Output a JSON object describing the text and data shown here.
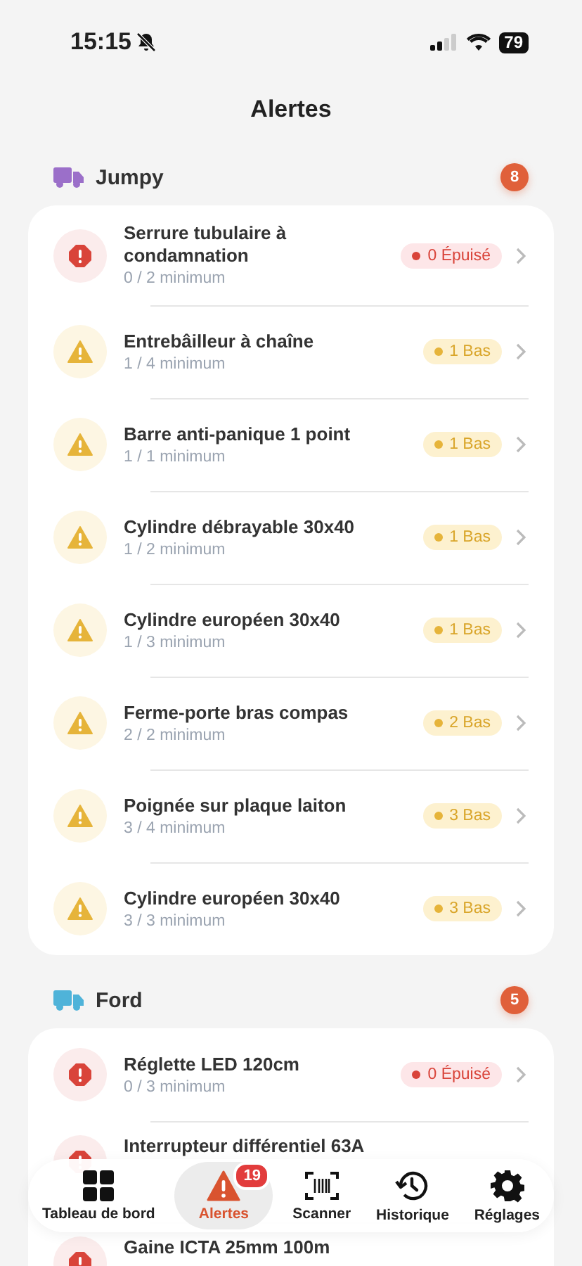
{
  "status_bar": {
    "time": "15:15",
    "battery": "79"
  },
  "title": "Alertes",
  "sections": [
    {
      "name": "Jumpy",
      "color": "#9b6fc9",
      "count": "8",
      "items": [
        {
          "name": "Serrure tubulaire à condamnation",
          "stock": "0 / 2 minimum",
          "kind": "critical",
          "badge": "0 Épuisé"
        },
        {
          "name": "Entrebâilleur à chaîne",
          "stock": "1 / 4 minimum",
          "kind": "low",
          "badge": "1 Bas"
        },
        {
          "name": "Barre anti-panique 1 point",
          "stock": "1 / 1 minimum",
          "kind": "low",
          "badge": "1 Bas"
        },
        {
          "name": "Cylindre débrayable 30x40",
          "stock": "1 / 2 minimum",
          "kind": "low",
          "badge": "1 Bas"
        },
        {
          "name": "Cylindre européen 30x40",
          "stock": "1 / 3 minimum",
          "kind": "low",
          "badge": "1 Bas"
        },
        {
          "name": "Ferme-porte bras compas",
          "stock": "2 / 2 minimum",
          "kind": "low",
          "badge": "2 Bas"
        },
        {
          "name": "Poignée sur plaque laiton",
          "stock": "3 / 4 minimum",
          "kind": "low",
          "badge": "3 Bas"
        },
        {
          "name": "Cylindre européen 30x40",
          "stock": "3 / 3 minimum",
          "kind": "low",
          "badge": "3 Bas"
        }
      ]
    },
    {
      "name": "Ford",
      "color": "#4fb3d9",
      "count": "5",
      "items": [
        {
          "name": "Réglette LED 120cm",
          "stock": "0 / 3 minimum",
          "kind": "critical",
          "badge": "0 Épuisé"
        },
        {
          "name": "Interrupteur différentiel 63A",
          "kind": "critical"
        },
        {
          "name": "Gaine ICTA 25mm 100m",
          "kind": "critical"
        }
      ]
    }
  ],
  "tab_bar": [
    {
      "label": "Tableau de bord",
      "kind": "grid",
      "selected": false
    },
    {
      "label": "Alertes",
      "kind": "warning",
      "selected": true,
      "badge": "19"
    },
    {
      "label": "Scanner",
      "kind": "scan",
      "selected": false
    },
    {
      "label": "Historique",
      "kind": "history",
      "selected": false
    },
    {
      "label": "Réglages",
      "kind": "gear",
      "selected": false
    }
  ]
}
